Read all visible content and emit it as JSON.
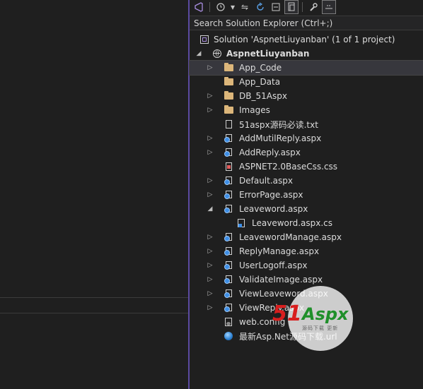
{
  "search": {
    "placeholder": "Search Solution Explorer (Ctrl+;)"
  },
  "toolbar": {
    "icons": [
      "vs-icon",
      "history-icon",
      "chevron-down-icon",
      "sync-icon",
      "refresh-icon",
      "collapse-all-icon",
      "show-all-files-icon",
      "properties-wrench-icon",
      "preview-icon"
    ]
  },
  "tree": {
    "solution_label": "Solution 'AspnetLiuyanban' (1 of 1 project)",
    "project_label": "AspnetLiuyanban",
    "items": [
      {
        "label": "App_Code",
        "icon": "folder-icon",
        "expander": "collapsed"
      },
      {
        "label": "App_Data",
        "icon": "folder-icon",
        "expander": "none"
      },
      {
        "label": "DB_51Aspx",
        "icon": "folder-icon",
        "expander": "collapsed"
      },
      {
        "label": "Images",
        "icon": "folder-icon",
        "expander": "collapsed"
      },
      {
        "label": "51aspx源码必读.txt",
        "icon": "text-file-icon",
        "expander": "none"
      },
      {
        "label": "AddMutilReply.aspx",
        "icon": "aspx-file-icon",
        "expander": "collapsed"
      },
      {
        "label": "AddReply.aspx",
        "icon": "aspx-file-icon",
        "expander": "collapsed"
      },
      {
        "label": "ASPNET2.0BaseCss.css",
        "icon": "css-file-icon",
        "expander": "none"
      },
      {
        "label": "Default.aspx",
        "icon": "aspx-file-icon",
        "expander": "collapsed"
      },
      {
        "label": "ErrorPage.aspx",
        "icon": "aspx-file-icon",
        "expander": "collapsed"
      },
      {
        "label": "Leaveword.aspx",
        "icon": "aspx-file-icon",
        "expander": "expanded"
      },
      {
        "label": "Leaveword.aspx.cs",
        "icon": "csharp-file-icon",
        "expander": "none",
        "indent": 2
      },
      {
        "label": "LeavewordManage.aspx",
        "icon": "aspx-file-icon",
        "expander": "collapsed"
      },
      {
        "label": "ReplyManage.aspx",
        "icon": "aspx-file-icon",
        "expander": "collapsed"
      },
      {
        "label": "UserLogoff.aspx",
        "icon": "aspx-file-icon",
        "expander": "collapsed"
      },
      {
        "label": "ValidateImage.aspx",
        "icon": "aspx-file-icon",
        "expander": "collapsed"
      },
      {
        "label": "ViewLeaveword.aspx",
        "icon": "aspx-file-icon",
        "expander": "collapsed"
      },
      {
        "label": "ViewReply.aspx",
        "icon": "aspx-file-icon",
        "expander": "collapsed"
      },
      {
        "label": "web.config",
        "icon": "config-file-icon",
        "expander": "none"
      },
      {
        "label": "最新Asp.Net源码下载.url",
        "icon": "url-file-icon",
        "expander": "none"
      }
    ],
    "selected_index": 0
  },
  "watermark": {
    "brand_number": "51",
    "brand_name": "Aspx",
    "tagline": "源码下载 更新"
  }
}
